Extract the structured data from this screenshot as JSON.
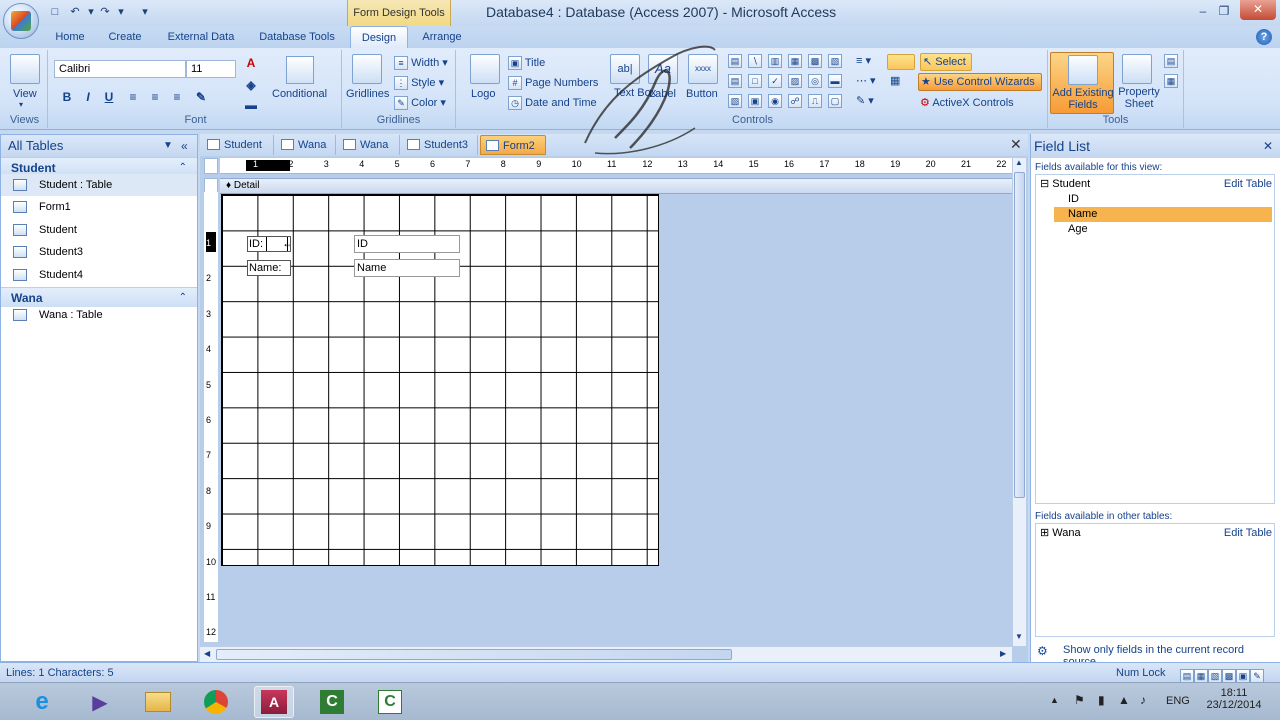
{
  "window": {
    "title": "Database4 : Database (Access 2007) - Microsoft Access",
    "contextual_tab_group": "Form Design Tools"
  },
  "ribbon_tabs": [
    "Home",
    "Create",
    "External Data",
    "Database Tools",
    "Design",
    "Arrange"
  ],
  "ribbon": {
    "views": {
      "view_label": "View",
      "group_label": "Views"
    },
    "font": {
      "font_name": "Calibri",
      "font_size": "11",
      "conditional_label": "Conditional",
      "group_label": "Font"
    },
    "gridlines": {
      "gridlines_label": "Gridlines",
      "width_label": "Width",
      "style_label": "Style",
      "color_label": "Color",
      "group_label": "Gridlines"
    },
    "controls": {
      "logo_label": "Logo",
      "title_label": "Title",
      "page_numbers_label": "Page Numbers",
      "date_time_label": "Date and Time",
      "textbox_label": "Text Box",
      "label_label": "Label",
      "button_label": "Button",
      "select_label": "Select",
      "use_wizards_label": "Use Control Wizards",
      "activex_label": "ActiveX Controls",
      "group_label": "Controls"
    },
    "tools": {
      "add_existing_label": "Add Existing Fields",
      "property_sheet_label": "Property Sheet",
      "group_label": "Tools"
    }
  },
  "nav_pane": {
    "header": "All Tables",
    "groups": [
      {
        "name": "Student",
        "items": [
          "Student : Table",
          "Form1",
          "Student",
          "Student3",
          "Student4"
        ]
      },
      {
        "name": "Wana",
        "items": [
          "Wana : Table"
        ]
      }
    ]
  },
  "document_tabs": [
    "Student",
    "Wana",
    "Wana",
    "Student3",
    "Form2"
  ],
  "form_design": {
    "section_label": "Detail",
    "ruler_h": [
      "1",
      "2",
      "3",
      "4",
      "5",
      "6",
      "7",
      "8",
      "9",
      "10",
      "11",
      "12",
      "13",
      "14",
      "15",
      "16",
      "17",
      "18",
      "19",
      "20",
      "21",
      "22"
    ],
    "ruler_v": [
      "1",
      "2",
      "3",
      "4",
      "5",
      "6",
      "7",
      "8",
      "9",
      "10",
      "11",
      "12"
    ],
    "controls": [
      {
        "label": "ID:",
        "textbox": "ID"
      },
      {
        "label": "Name:",
        "textbox": "Name"
      }
    ]
  },
  "field_list": {
    "title": "Field List",
    "available_caption": "Fields available for this view:",
    "table_name": "Student",
    "edit_table_label": "Edit Table",
    "fields": [
      "ID",
      "Name",
      "Age"
    ],
    "selected_field": "Name",
    "other_caption": "Fields available in other tables:",
    "other_table": "Wana",
    "other_edit_label": "Edit Table",
    "show_only_label": "Show only fields in the current record source"
  },
  "statusbar": {
    "lines": "Lines: 1  Characters: 5",
    "num_lock": "Num Lock"
  },
  "taskbar": {
    "lang": "ENG",
    "time": "18:11",
    "date": "23/12/2014"
  },
  "colors": {
    "accent": "#15428b",
    "highlight": "#f7a744",
    "selected_field": "#f7b34d"
  }
}
